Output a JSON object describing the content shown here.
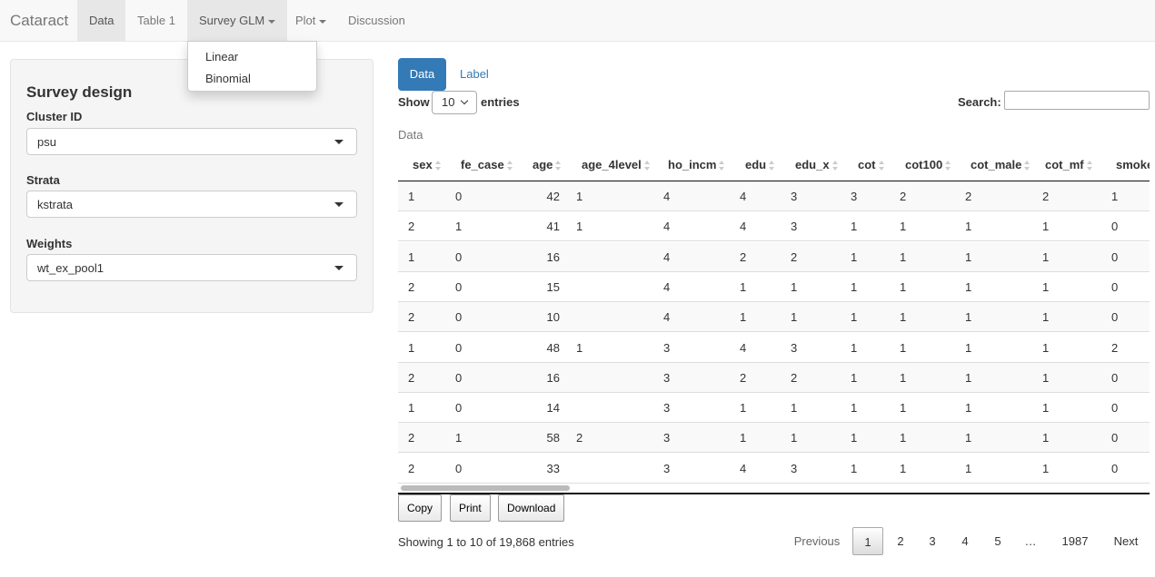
{
  "app": {
    "brand": "Cataract",
    "nav": [
      "Data",
      "Table 1",
      "Survey GLM",
      "Plot",
      "Discussion"
    ],
    "dropdown_items": [
      "Linear",
      "Binomial"
    ]
  },
  "sidebar": {
    "title": "Survey design",
    "fields": [
      {
        "label": "Cluster ID",
        "value": "psu"
      },
      {
        "label": "Strata",
        "value": "kstrata"
      },
      {
        "label": "Weights",
        "value": "wt_ex_pool1"
      }
    ]
  },
  "main": {
    "tabs": [
      "Data",
      "Label"
    ],
    "show_label": "Show",
    "entries_value": "10",
    "entries_label": "entries",
    "search_label": "Search:",
    "search_value": "",
    "caption": "Data",
    "columns": [
      "sex",
      "fe_case",
      "age",
      "age_4level",
      "ho_incm",
      "edu",
      "edu_x",
      "cot",
      "cot100",
      "cot_male",
      "cot_mf",
      "smoke"
    ],
    "rows": [
      [
        "1",
        "0",
        "42",
        "1",
        "4",
        "4",
        "3",
        "3",
        "2",
        "2",
        "2",
        "1"
      ],
      [
        "2",
        "1",
        "41",
        "1",
        "4",
        "4",
        "3",
        "1",
        "1",
        "1",
        "1",
        "0"
      ],
      [
        "1",
        "0",
        "16",
        "",
        "4",
        "2",
        "2",
        "1",
        "1",
        "1",
        "1",
        "0"
      ],
      [
        "2",
        "0",
        "15",
        "",
        "4",
        "1",
        "1",
        "1",
        "1",
        "1",
        "1",
        "0"
      ],
      [
        "2",
        "0",
        "10",
        "",
        "4",
        "1",
        "1",
        "1",
        "1",
        "1",
        "1",
        "0"
      ],
      [
        "1",
        "0",
        "48",
        "1",
        "3",
        "4",
        "3",
        "1",
        "1",
        "1",
        "1",
        "2"
      ],
      [
        "2",
        "0",
        "16",
        "",
        "3",
        "2",
        "2",
        "1",
        "1",
        "1",
        "1",
        "0"
      ],
      [
        "1",
        "0",
        "14",
        "",
        "3",
        "1",
        "1",
        "1",
        "1",
        "1",
        "1",
        "0"
      ],
      [
        "2",
        "1",
        "58",
        "2",
        "3",
        "1",
        "1",
        "1",
        "1",
        "1",
        "1",
        "0"
      ],
      [
        "2",
        "0",
        "33",
        "",
        "3",
        "4",
        "3",
        "1",
        "1",
        "1",
        "1",
        "0"
      ]
    ],
    "buttons": [
      "Copy",
      "Print",
      "Download"
    ],
    "info": "Showing 1 to 10 of 19,868 entries",
    "pagination": [
      "Previous",
      "1",
      "2",
      "3",
      "4",
      "5",
      "…",
      "1987",
      "Next"
    ]
  }
}
